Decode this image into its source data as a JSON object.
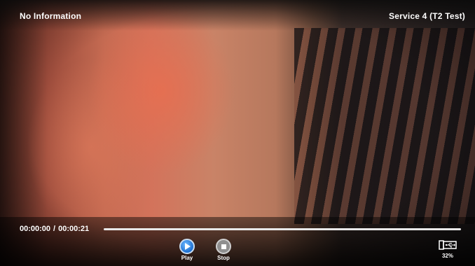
{
  "header": {
    "info_text": "No Information",
    "service_text": "Service 4 (T2 Test)"
  },
  "playback": {
    "current_time": "00:00:00",
    "separator": "/",
    "total_time": "00:00:21",
    "progress_fraction": 0.0
  },
  "controls": {
    "play_label": "Play",
    "stop_label": "Stop"
  },
  "storage": {
    "icon": "usb-drive-icon",
    "usage_text": "32%"
  },
  "colors": {
    "accent": "#5ab5ff",
    "play_button": "#1c6fd1",
    "stop_button": "#8f8f8f"
  }
}
